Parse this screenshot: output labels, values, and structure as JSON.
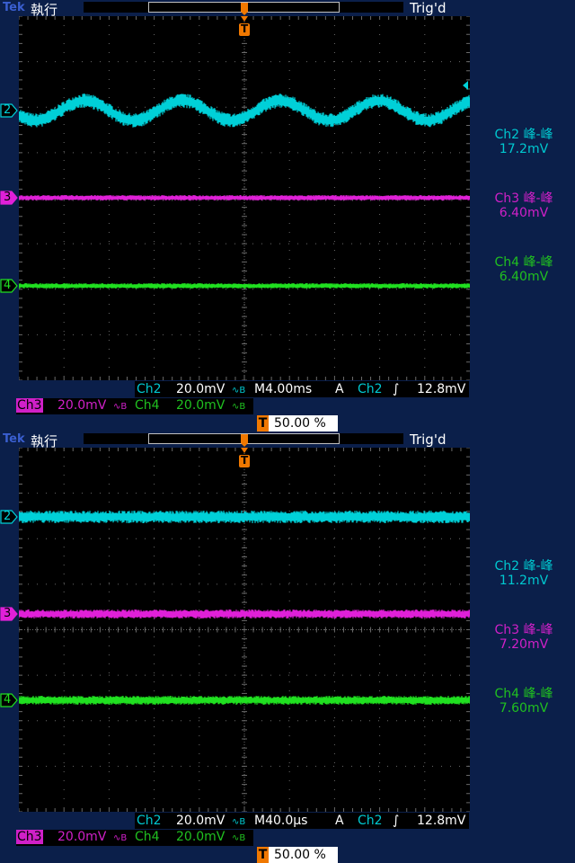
{
  "panels": [
    {
      "brand": "Tek",
      "run_state": "執行",
      "trig_status": "Trig'd",
      "trig_marker": "T",
      "markers": {
        "ch2": "2",
        "ch3": "3",
        "ch4": "4"
      },
      "measurements": [
        {
          "label": "Ch2 峰-峰",
          "value": "17.2mV"
        },
        {
          "label": "Ch3 峰-峰",
          "value": "6.40mV"
        },
        {
          "label": "Ch4 峰-峰",
          "value": "6.40mV"
        }
      ],
      "ch2_scale_label": "Ch2",
      "ch2_scale": "20.0mV",
      "ch3_scale_label": "Ch3",
      "ch3_scale": "20.0mV",
      "ch4_scale_label": "Ch4",
      "ch4_scale": "20.0mV",
      "bw_symbol": "∿B",
      "timebase": "M4.00ms",
      "trigger_mode": "A",
      "trigger_source": "Ch2",
      "trigger_slope": "∫",
      "trigger_level": "12.8mV",
      "trigger_position": "50.00 %",
      "wave_type": "sine"
    },
    {
      "brand": "Tek",
      "run_state": "執行",
      "trig_status": "Trig'd",
      "trig_marker": "T",
      "markers": {
        "ch2": "2",
        "ch3": "3",
        "ch4": "4"
      },
      "measurements": [
        {
          "label": "Ch2 峰-峰",
          "value": "11.2mV"
        },
        {
          "label": "Ch3 峰-峰",
          "value": "7.20mV"
        },
        {
          "label": "Ch4 峰-峰",
          "value": "7.60mV"
        }
      ],
      "ch2_scale_label": "Ch2",
      "ch2_scale": "20.0mV",
      "ch3_scale_label": "Ch3",
      "ch3_scale": "20.0mV",
      "ch4_scale_label": "Ch4",
      "ch4_scale": "20.0mV",
      "bw_symbol": "∿B",
      "timebase": "M40.0µs",
      "trigger_mode": "A",
      "trigger_source": "Ch2",
      "trigger_slope": "∫",
      "trigger_level": "12.8mV",
      "trigger_position": "50.00 %",
      "wave_type": "noise"
    }
  ],
  "colors": {
    "ch2": "#00d0d8",
    "ch3": "#e020d8",
    "ch4": "#20e020",
    "grid": "#6a6a6a"
  }
}
